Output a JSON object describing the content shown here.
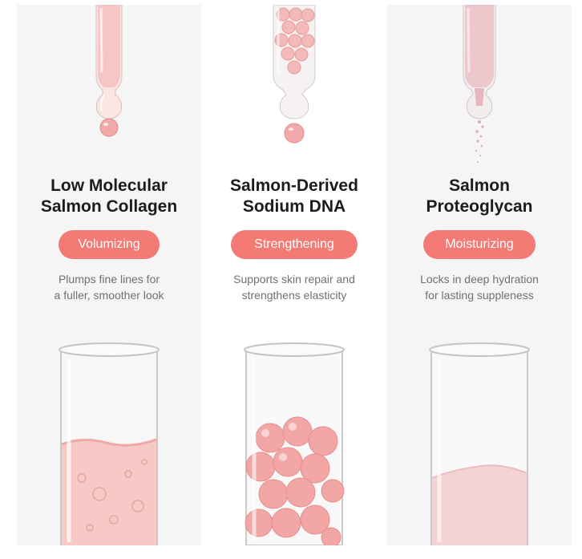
{
  "colors": {
    "badge": "#f47a76",
    "title": "#1c1c1c",
    "description": "#707070",
    "collagen_liquid": "#f6c9c6",
    "dna_beads": "#f2a7a6",
    "proteoglycan_powder": "#f4d3d4"
  },
  "ingredients": [
    {
      "title_line1": "Low Molecular",
      "title_line2": "Salmon Collagen",
      "badge": "Volumizing",
      "desc_line1": "Plumps fine lines for",
      "desc_line2": "a fuller, smoother look",
      "dropper_icon": "serum-dropper-icon",
      "tube_icon": "liquid-test-tube-icon"
    },
    {
      "title_line1": "Salmon-Derived",
      "title_line2": "Sodium DNA",
      "badge": "Strengthening",
      "desc_line1": "Supports skin repair and",
      "desc_line2": "strengthens elasticity",
      "dropper_icon": "bead-dropper-icon",
      "tube_icon": "beads-test-tube-icon"
    },
    {
      "title_line1": "Salmon",
      "title_line2": "Proteoglycan",
      "badge": "Moisturizing",
      "desc_line1": "Locks in deep hydration",
      "desc_line2": "for lasting suppleness",
      "dropper_icon": "powder-dropper-icon",
      "tube_icon": "powder-test-tube-icon"
    }
  ]
}
